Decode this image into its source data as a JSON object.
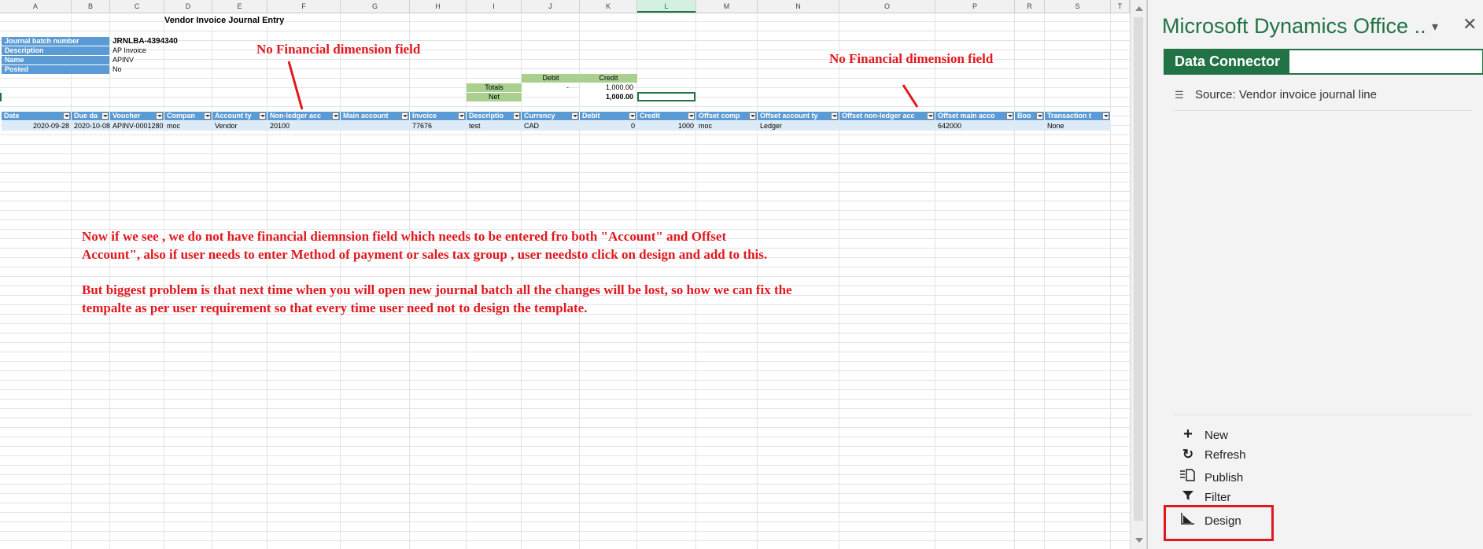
{
  "sheet": {
    "columns": [
      "A",
      "B",
      "C",
      "D",
      "E",
      "F",
      "G",
      "H",
      "I",
      "J",
      "K",
      "L",
      "M",
      "N",
      "O",
      "P",
      "R",
      "S",
      "T"
    ],
    "title": "Vendor Invoice Journal Entry",
    "info_labels": [
      "Journal batch number",
      "Description",
      "Name",
      "Posted"
    ],
    "info_values": [
      "JRNLBA-4394340",
      "AP Invoice",
      "APINV",
      "No"
    ],
    "totals": {
      "debit_header": "Debit",
      "credit_header": "Credit",
      "totals_label": "Totals",
      "net_label": "Net",
      "totals_debit": "-",
      "totals_credit": "1,000.00",
      "net_credit": "1,000.00"
    },
    "table_headers": [
      "Date",
      "Due da",
      "Voucher",
      "Compan",
      "Account ty",
      "Non-ledger acc",
      "Main account",
      "Invoice",
      "Descriptio",
      "Currency",
      "Debit",
      "Credit",
      "Offset comp",
      "Offset account ty",
      "Offset non-ledger acc",
      "Offset main acco",
      "Boo",
      "Transaction t"
    ],
    "table_row": [
      "2020-09-28",
      "2020-10-08",
      "APINV-0001280",
      "moc",
      "Vendor",
      "20100",
      "",
      "77676",
      "test",
      "CAD",
      "0",
      "1000",
      "moc",
      "Ledger",
      "",
      "642000",
      "",
      "None"
    ]
  },
  "annotations": {
    "left_callout": "No Financial dimension field",
    "right_callout": "No Financial dimension field",
    "para1_line1": "Now if we see , we do not have financial diemnsion field which needs to be entered fro both \"Account\" and Offset",
    "para1_line2": "Account\", also if user needs to enter Method of payment or sales tax group , user needsto click on design and add to this.",
    "para2_line1": "But biggest problem is that next time when you will open new journal batch all the changes will be lost, so how we can fix the",
    "para2_line2": "tempalte as per user requirement so that every time user need  not to design the template."
  },
  "pane": {
    "title": "Microsoft Dynamics Office ..",
    "tab": "Data Connector",
    "source": "Source: Vendor invoice journal line",
    "commands": [
      {
        "label": "New",
        "icon": "plus-icon"
      },
      {
        "label": "Refresh",
        "icon": "refresh-icon"
      },
      {
        "label": "Publish",
        "icon": "publish-icon"
      },
      {
        "label": "Filter",
        "icon": "filter-icon"
      },
      {
        "label": "Design",
        "icon": "design-icon"
      }
    ]
  },
  "colors": {
    "accent": "#217346",
    "table_header": "#5b9bd5",
    "annotation": "#e0191f"
  }
}
